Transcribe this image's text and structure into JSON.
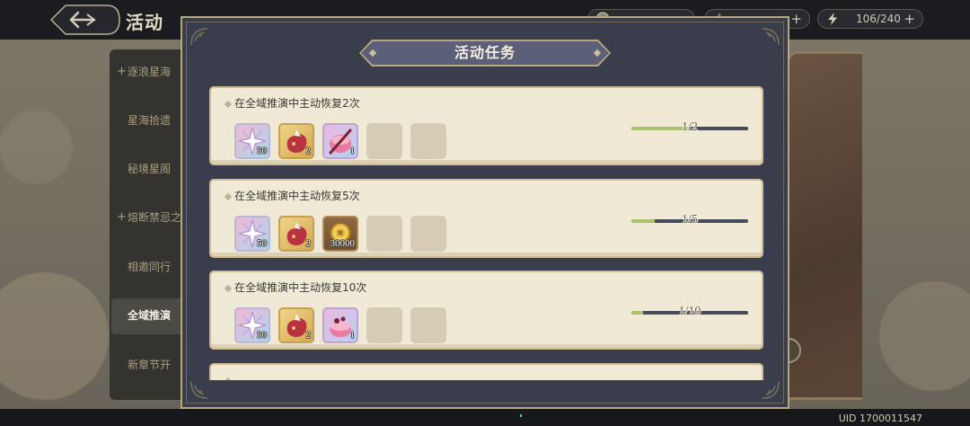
{
  "header": {
    "title": "活动"
  },
  "resources": {
    "energy": "106/240",
    "energy_icon": "lightning-icon"
  },
  "sidebar": {
    "items": [
      {
        "prefix": "+",
        "label": "逐浪星海"
      },
      {
        "label": "星海拾遗"
      },
      {
        "label": "秘境星阁"
      },
      {
        "prefix": "+",
        "label": "熔断禁忌之"
      },
      {
        "label": "相邀同行"
      },
      {
        "label": "全域推演",
        "selected": true
      },
      {
        "label": "新章节开"
      }
    ]
  },
  "modal": {
    "title": "活动任务",
    "tasks": [
      {
        "description": "在全域推演中主动恢复2次",
        "progress_text": "1/2",
        "progress": 0.5,
        "rewards": [
          {
            "icon": "star-shard-icon",
            "count": "50"
          },
          {
            "icon": "red-pouch-icon",
            "count": "2"
          },
          {
            "icon": "pink-drum-icon",
            "count": "1"
          }
        ],
        "empty_slots": 2
      },
      {
        "description": "在全域推演中主动恢复5次",
        "progress_text": "1/5",
        "progress": 0.2,
        "rewards": [
          {
            "icon": "star-shard-icon",
            "count": "50"
          },
          {
            "icon": "red-pouch-icon",
            "count": "2"
          },
          {
            "icon": "gold-coin-icon",
            "count": "30000"
          }
        ],
        "empty_slots": 2
      },
      {
        "description": "在全域推演中主动恢复10次",
        "progress_text": "1/10",
        "progress": 0.1,
        "rewards": [
          {
            "icon": "star-shard-icon",
            "count": "50"
          },
          {
            "icon": "red-pouch-icon",
            "count": "2"
          },
          {
            "icon": "pink-pot-icon",
            "count": "1"
          }
        ],
        "empty_slots": 2
      }
    ]
  },
  "footer": {
    "uid": "UID 1700011547"
  },
  "colors": {
    "modal_bg": "#3a3d4c",
    "card_bg": "#efe9d6",
    "gold_trim": "#b7a77c",
    "progress_fill": "#a8c36b",
    "progress_track": "#474b59"
  }
}
